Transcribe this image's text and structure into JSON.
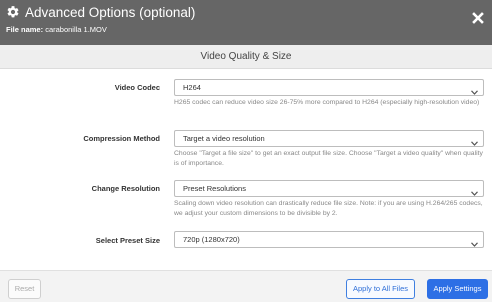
{
  "header": {
    "title": "Advanced Options (optional)",
    "file_label": "File name:",
    "file_name": "carabonilla 1.MOV"
  },
  "section": {
    "title": "Video Quality & Size"
  },
  "fields": {
    "video_codec": {
      "label": "Video Codec",
      "value": "H264",
      "help": "H265 codec can reduce video size 26-75% more compared to H264 (especially high-resolution video)"
    },
    "compression_method": {
      "label": "Compression Method",
      "value": "Target a video resolution",
      "help": "Choose \"Target a file size\" to get an exact output file size. Choose \"Target a video quality\" when quality is of importance."
    },
    "change_resolution": {
      "label": "Change Resolution",
      "value": "Preset Resolutions",
      "help": "Scaling down video resolution can drastically reduce file size. Note: if you are using H.264/265 codecs, we adjust your custom dimensions to be divisible by 2."
    },
    "preset_size": {
      "label": "Select Preset Size",
      "value": "720p (1280x720)"
    }
  },
  "footer": {
    "reset_label": "Reset",
    "apply_all_label": "Apply to All Files",
    "apply_label": "Apply Settings"
  },
  "colors": {
    "header_bg": "#666666",
    "primary": "#2d6fe5"
  }
}
